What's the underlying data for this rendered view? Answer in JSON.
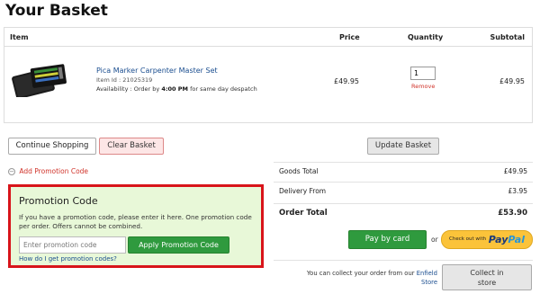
{
  "page": {
    "title": "Your Basket"
  },
  "table": {
    "headers": {
      "item": "Item",
      "price": "Price",
      "quantity": "Quantity",
      "subtotal": "Subtotal"
    },
    "row": {
      "name": "Pica Marker Carpenter Master Set",
      "item_id": "Item Id : 21025319",
      "availability_prefix": "Availability : Order by ",
      "availability_time": "4:00 PM",
      "availability_suffix": " for same day despatch",
      "price": "£49.95",
      "quantity": "1",
      "remove": "Remove",
      "subtotal": "£49.95"
    }
  },
  "actions": {
    "continue_shopping": "Continue Shopping",
    "clear_basket": "Clear Basket",
    "update_basket": "Update Basket"
  },
  "promo": {
    "toggle_icon": "−",
    "add_link": "Add Promotion Code",
    "title": "Promotion Code",
    "description": "If you have a promotion code, please enter it here. One promotion code per order. Offers cannot be combined.",
    "input_placeholder": "Enter promotion code",
    "apply": "Apply Promotion Code",
    "help": "How do I get promotion codes?"
  },
  "summary": {
    "goods_total_label": "Goods Total",
    "goods_total": "£49.95",
    "delivery_label": "Delivery From",
    "delivery": "£3.95",
    "order_total_label": "Order Total",
    "order_total": "£53.90"
  },
  "payment": {
    "pay_by_card": "Pay by card",
    "or": "or",
    "checkout_with": "Check out with",
    "paypal_part1": "Pay",
    "paypal_part2": "Pal"
  },
  "collect": {
    "text": "You can collect your order from our ",
    "link": "Enfield Store",
    "button_line1": "Collect in",
    "button_line2": "store"
  },
  "colors": {
    "accent_red": "#d8141a",
    "promo_bg": "#e8f8d8",
    "green_button": "#2f9a3e",
    "link_blue": "#1a4d8f",
    "paypal_yellow": "#fbc33a"
  }
}
